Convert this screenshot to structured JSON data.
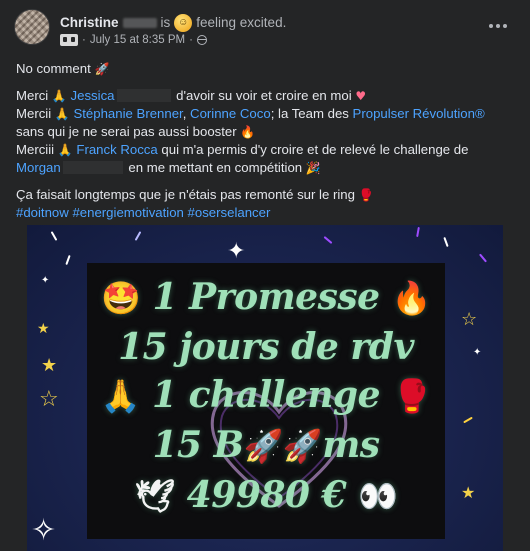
{
  "post": {
    "author": "Christine",
    "is_text": "is",
    "feeling_emoji": "☺",
    "feeling": "feeling excited.",
    "date": "July 15 at 8:35 PM",
    "separator": "·"
  },
  "body": {
    "first_line": {
      "text": "No comment",
      "emoji": "🚀"
    },
    "merci_lines": [
      {
        "prefix": "Merci ",
        "pray": "🙏",
        "name": "Jessica",
        "rest": " d'avoir su voir et croire en moi ",
        "emoji": "♥"
      },
      {
        "prefix": "Mercii ",
        "pray": "🙏",
        "name1": "Stéphanie Brenner",
        "sep": ", ",
        "name2": "Corinne Coco",
        "mid": "; la Team des ",
        "name3": "Propulser Révolution®"
      },
      {
        "text": "sans qui je ne serai pas aussi booster ",
        "emoji": "🔥"
      },
      {
        "prefix": "Merciii ",
        "pray": "🙏",
        "name": "Franck Rocca",
        "rest": " qui m'a permis d'y croire et de relevé le challenge de"
      },
      {
        "name": "Morgan",
        "rest": " en me mettant en compétition ",
        "emoji": "🎉"
      }
    ],
    "ring_line": {
      "text": "Ça faisait longtemps que je n'étais pas remonté sur le ring ",
      "emoji": "🥊"
    },
    "hashtags": "#doitnow #energiemotivation #oserselancer"
  },
  "image": {
    "line1": {
      "emoji_left": "🤩",
      "text": "1 Promesse",
      "emoji_right": "🔥"
    },
    "line2": {
      "text": "15 jours de rdv"
    },
    "line3": {
      "emoji_left": "🙏",
      "text": "1 challenge",
      "emoji_right": "🥊"
    },
    "line4": {
      "text_a": "15 B",
      "emoji_1": "🚀",
      "emoji_2": "🚀",
      "text_b": "ms"
    },
    "line5": {
      "emoji_left": "🕊",
      "text": "49980 €",
      "emoji_right": "👀"
    }
  },
  "colors": {
    "background": "#242526",
    "link": "#4da3ff",
    "promo_text": "#9fe0b8",
    "image_bg": "#1b2550"
  }
}
